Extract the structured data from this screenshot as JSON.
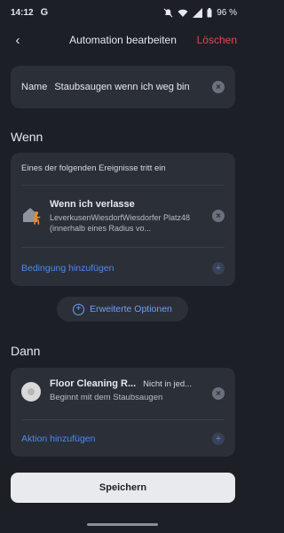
{
  "status_bar": {
    "time": "14:12",
    "app_icon": "G",
    "battery": "96 %",
    "icons": [
      "mute-icon",
      "wifi-icon",
      "signal-icon",
      "battery-icon"
    ]
  },
  "app_bar": {
    "title": "Automation bearbeiten",
    "delete_label": "Löschen",
    "back_icon": "‹"
  },
  "name_field": {
    "label": "Name",
    "value": "Staubsaugen wenn ich weg bin"
  },
  "when_section": {
    "title": "Wenn",
    "subtitle": "Eines der folgenden Ereignisse tritt ein",
    "trigger": {
      "name": "Wenn ich verlasse",
      "description": "LeverkusenWiesdorfWiesdorfer Platz48 (innerhalb eines Radius vo..."
    },
    "add_condition_label": "Bedingung hinzufügen"
  },
  "advanced_options_label": "Erweiterte Optionen",
  "then_section": {
    "title": "Dann",
    "action": {
      "name": "Floor Cleaning R...",
      "state": "Nicht in jed...",
      "description": "Beginnt mit dem Staubsaugen"
    },
    "add_action_label": "Aktion hinzufügen"
  },
  "save_label": "Speichern",
  "colors": {
    "background": "#1c1f26",
    "card": "#2b2f38",
    "accent": "#4d8bf0",
    "danger": "#e24a4a",
    "trigger_person": "#f08a24"
  }
}
